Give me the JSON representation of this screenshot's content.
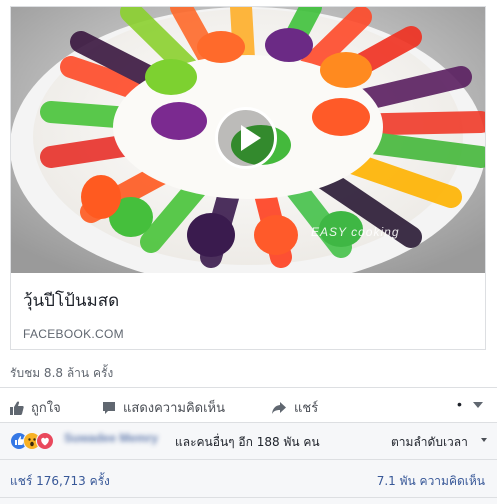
{
  "post": {
    "link_title": "วุ้นปีโป้นมสด",
    "link_domain": "FACEBOOK.COM",
    "watermark": "EASY cooking",
    "views_text": "รับชม 8.8 ล้าน ครั้ง"
  },
  "actions": {
    "like_label": "ถูกใจ",
    "comment_label": "แสดงความคิดเห็น",
    "share_label": "แชร์",
    "more_dot": "•"
  },
  "reactions": {
    "types": [
      "like",
      "wow",
      "love"
    ],
    "blurred_name": "Suwadee Memry",
    "others_text": "และคนอื่นๆ อีก 188 พัน คน",
    "sort_label": "ตามลำดับเวลา"
  },
  "stats": {
    "shares_text": "แชร์ 176,713 ครั้ง",
    "comments_text": "7.1 พัน ความคิดเห็น"
  },
  "colors": {
    "link_blue": "#385898",
    "like_blue": "#3578e5",
    "wow_yellow": "#f7b125",
    "love_red": "#e9485c",
    "border": "#dddfe2"
  }
}
